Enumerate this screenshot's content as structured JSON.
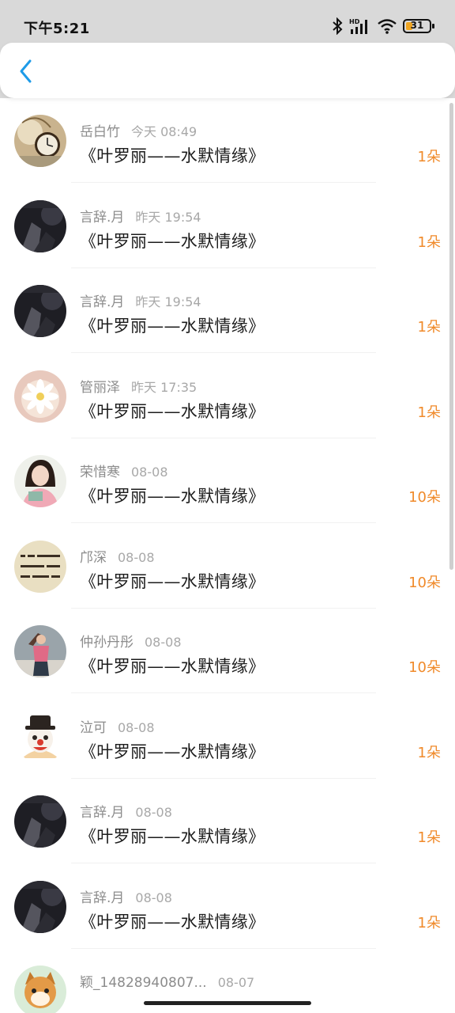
{
  "status_bar": {
    "time": "下午5:21",
    "battery_level": "31",
    "icons": [
      "bluetooth-icon",
      "signal-hd-icon",
      "wifi-icon",
      "battery-icon"
    ]
  },
  "header": {
    "back_icon": "chevron-left-icon",
    "accent_color": "#1e9be8"
  },
  "count_color": "#f08a2a",
  "items": [
    {
      "name": "岳白竹",
      "time": "今天 08:49",
      "title": "《叶罗丽——水默情缘》",
      "count": "1朵",
      "avatar": "pocket-watch"
    },
    {
      "name": "言辞.月",
      "time": "昨天 19:54",
      "title": "《叶罗丽——水默情缘》",
      "count": "1朵",
      "avatar": "dark-photo"
    },
    {
      "name": "言辞.月",
      "time": "昨天 19:54",
      "title": "《叶罗丽——水默情缘》",
      "count": "1朵",
      "avatar": "dark-photo"
    },
    {
      "name": "管丽泽",
      "time": "昨天 17:35",
      "title": "《叶罗丽——水默情缘》",
      "count": "1朵",
      "avatar": "white-flower"
    },
    {
      "name": "荣惜寒",
      "time": "08-08",
      "title": "《叶罗丽——水默情缘》",
      "count": "10朵",
      "avatar": "girl-portrait"
    },
    {
      "name": "邝深",
      "time": "08-08",
      "title": "《叶罗丽——水默情缘》",
      "count": "10朵",
      "avatar": "calligraphy"
    },
    {
      "name": "仲孙丹彤",
      "time": "08-08",
      "title": "《叶罗丽——水默情缘》",
      "count": "10朵",
      "avatar": "girl-pink-top"
    },
    {
      "name": "泣可",
      "time": "08-08",
      "title": "《叶罗丽——水默情缘》",
      "count": "1朵",
      "avatar": "clown"
    },
    {
      "name": "言辞.月",
      "time": "08-08",
      "title": "《叶罗丽——水默情缘》",
      "count": "1朵",
      "avatar": "dark-photo"
    },
    {
      "name": "言辞.月",
      "time": "08-08",
      "title": "《叶罗丽——水默情缘》",
      "count": "1朵",
      "avatar": "dark-photo"
    },
    {
      "name": "颖_14828940807...",
      "time": "08-07",
      "title": "",
      "count": "",
      "avatar": "cartoon-cat"
    }
  ]
}
